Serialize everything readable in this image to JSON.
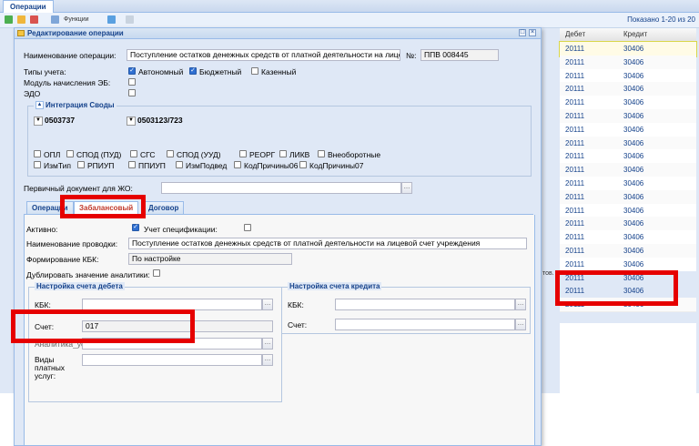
{
  "app": {
    "tab_label": "Операции",
    "toolbar_func": "Функции",
    "shown_count": "Показано 1-20 из 20"
  },
  "grid": {
    "headers": [
      "Дебет",
      "Кредит"
    ],
    "rows": [
      [
        "20111",
        "30406"
      ],
      [
        "20111",
        "30406"
      ],
      [
        "20111",
        "30406"
      ],
      [
        "20111",
        "30406"
      ],
      [
        "20111",
        "30406"
      ],
      [
        "20111",
        "30406"
      ],
      [
        "20111",
        "30406"
      ],
      [
        "20111",
        "30406"
      ],
      [
        "20111",
        "30406"
      ],
      [
        "20111",
        "30406"
      ],
      [
        "20111",
        "30406"
      ],
      [
        "20111",
        "30406"
      ],
      [
        "20111",
        "30406"
      ],
      [
        "20111",
        "30406"
      ],
      [
        "20111",
        "30406"
      ],
      [
        "20111",
        "30406"
      ],
      [
        "20111",
        "30406"
      ],
      [
        "20111",
        "30406"
      ],
      [
        "20111",
        "30406"
      ],
      [
        "20111",
        "30406"
      ]
    ],
    "partial_left": "тов."
  },
  "dialog": {
    "title": "Редактирование операции",
    "op_name_label": "Наименование операции:",
    "op_name_value": "Поступление остатков денежных средств от платной деятельности на лицевс",
    "num_label": "№:",
    "num_value": "ППВ 008445",
    "acc_types_label": "Типы учета:",
    "acc_types": [
      {
        "label": "Автономный",
        "checked": true
      },
      {
        "label": "Бюджетный",
        "checked": true
      },
      {
        "label": "Казенный",
        "checked": false
      }
    ],
    "module_label": "Модуль начисления ЭБ:",
    "edo_label": "ЭДО",
    "integration": {
      "legend": "Интеграция Своды",
      "dropdown1": "0503737",
      "dropdown2": "0503123/723",
      "row1": [
        "ОПЛ",
        "СПОД (ПУД)",
        "СГС",
        "СПОД (УУД)",
        "РЕОРГ",
        "ЛИКВ",
        "Внеоборотные"
      ],
      "row2": [
        "ИзмТип",
        "РПИУП",
        "ППИУП",
        "ИзмПодвед",
        "КодПричины06",
        "КодПричины07"
      ]
    },
    "primary_doc_label": "Первичный документ для ЖО:",
    "primary_doc_value": "",
    "tabs": [
      "Операции",
      "Забалансовый",
      "Договор"
    ],
    "active_label": "Активно:",
    "spec_label": "Учет спецификации:",
    "posting_name_label": "Наименование проводки:",
    "posting_name_value": "Поступление остатков денежных средств от платной деятельности на лицевой счет учреждения",
    "kbk_form_label": "Формирование КБК:",
    "kbk_form_value": "По настройке",
    "dup_label": "Дублировать значение аналитики:",
    "debit": {
      "legend": "Настройка счета дебета",
      "kbk_label": "КБК:",
      "kbk_value": "",
      "account_label": "Счет:",
      "account_value": "017",
      "hidden_label": "Аналитика_услуг:",
      "services_label": "Виды платных услуг:"
    },
    "credit": {
      "legend": "Настройка счета кредита",
      "kbk_label": "КБК:",
      "kbk_value": "",
      "account_label": "Счет:",
      "account_value": ""
    }
  },
  "colors": {
    "highlight_box": "#e60000",
    "panel_bg": "#dfe8f6",
    "header_text": "#15428b"
  }
}
